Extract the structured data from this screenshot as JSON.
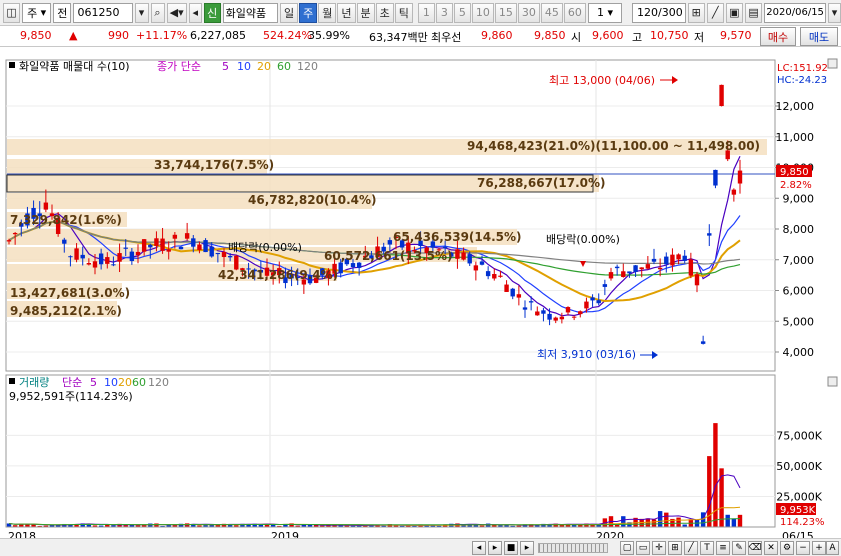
{
  "toolbar": {
    "mode": "주",
    "market": "전",
    "code": "061250",
    "badge": "신",
    "stock_name": "화일약품",
    "periods": [
      "일",
      "주",
      "월",
      "년",
      "분",
      "초",
      "틱"
    ],
    "active_period": "주",
    "intervals": [
      "1",
      "3",
      "5",
      "10",
      "15",
      "30",
      "45",
      "60"
    ],
    "interval_value": "1",
    "count": "120",
    "count_total": "/300",
    "date": "2020/06/15"
  },
  "info": {
    "price": "9,850",
    "arrow": "▲",
    "change": "990",
    "change_pct": "+11.17%",
    "volume": "6,227,085",
    "vol_ratio": "524.24%",
    "turnover": "35.99%",
    "amount": "63,347백만",
    "best_bid_label": "최우선",
    "best_ask": "9,860",
    "best_bid": "9,850",
    "open_label": "시",
    "open": "9,600",
    "high_label": "고",
    "high": "10,750",
    "low_label": "저",
    "low": "9,570",
    "buy_button": "매수",
    "sell_button": "매도"
  },
  "price_panel": {
    "legend_title": "화일약품 매물대 수(10)",
    "ma_label": "종가 단순",
    "ma_periods": [
      "5",
      "10",
      "20",
      "60",
      "120"
    ],
    "lc": "LC:151.92",
    "hc": "HC:-24.23",
    "high_marker": "최고 13,000 (04/06)",
    "low_marker": "최저 3,910 (03/16)",
    "dividend_1": "배당락(0.00%)",
    "dividend_2": "배당락(0.00%)",
    "current_price": "9,850",
    "current_pct": "2.82%",
    "y_ticks": [
      "12,000",
      "11,000",
      "10,000",
      "9,000",
      "8,000",
      "7,000",
      "6,000",
      "5,000",
      "4,000"
    ],
    "volume_profile": [
      {
        "label": "94,468,423(21.0%)(11,100.00 ~ 11,498.00)"
      },
      {
        "label": "33,744,176(7.5%)"
      },
      {
        "label": "76,288,667(17.0%)"
      },
      {
        "label": "46,782,820(10.4%)"
      },
      {
        "label": "7,329,842(1.6%)"
      },
      {
        "label": "65,436,539(14.5%)"
      },
      {
        "label": "60,572,661(13.5%)"
      },
      {
        "label": "42,341,286(9.4%)"
      },
      {
        "label": "13,427,681(3.0%)"
      },
      {
        "label": "9,485,212(2.1%)"
      }
    ]
  },
  "volume_panel": {
    "legend_title": "거래량",
    "ma_label": "단순",
    "ma_periods": [
      "5",
      "10",
      "20",
      "60",
      "120"
    ],
    "current": "9,952,591주(114.23%)",
    "y_ticks": [
      "75,000K",
      "50,000K",
      "25,000K"
    ],
    "current_tag": "9,953K",
    "current_pct": "114.23%"
  },
  "x_axis": {
    "labels": [
      "2018",
      "2019",
      "2020"
    ],
    "end_label": "06/15"
  },
  "colors": {
    "up": "#e00000",
    "down": "#0030d0",
    "ma5": "#4a00c0",
    "ma10": "#2040ff",
    "ma20": "#e0a000",
    "ma60": "#30a030",
    "ma120": "#808080",
    "profile": "#f5dfc0"
  }
}
